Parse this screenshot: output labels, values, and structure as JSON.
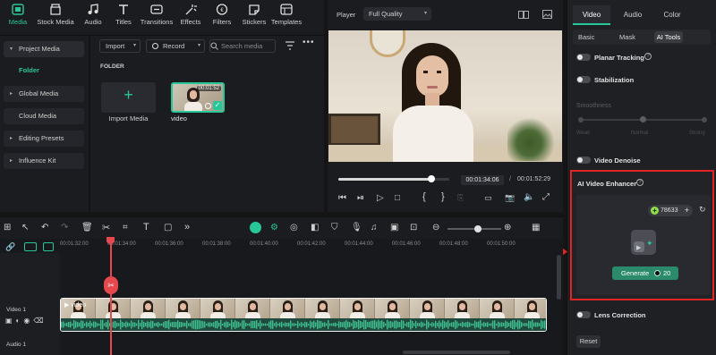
{
  "toolbar": {
    "tabs": [
      {
        "label": "Media",
        "icon": "media-icon",
        "active": true
      },
      {
        "label": "Stock Media",
        "icon": "stock-media-icon"
      },
      {
        "label": "Audio",
        "icon": "audio-icon"
      },
      {
        "label": "Titles",
        "icon": "titles-icon"
      },
      {
        "label": "Transitions",
        "icon": "transitions-icon"
      },
      {
        "label": "Effects",
        "icon": "effects-icon"
      },
      {
        "label": "Filters",
        "icon": "filters-icon"
      },
      {
        "label": "Stickers",
        "icon": "stickers-icon"
      },
      {
        "label": "Templates",
        "icon": "templates-icon"
      }
    ]
  },
  "sidenav": {
    "project_media": "Project Media",
    "folder": "Folder",
    "global_media": "Global Media",
    "cloud_media": "Cloud Media",
    "editing_presets": "Editing Presets",
    "influence_kit": "Influence Kit"
  },
  "media": {
    "import_label": "Import",
    "record_label": "Record",
    "search_placeholder": "Search media",
    "folder_heading": "FOLDER",
    "import_media_label": "Import Media",
    "clip_name": "video",
    "clip_duration": "00:01:52"
  },
  "player": {
    "label": "Player",
    "quality": "Full Quality",
    "current_time": "00:01:34:06",
    "separator": "/",
    "total_time": "00:01:52:29",
    "progress": 0.84
  },
  "inspector": {
    "tabs": [
      "Video",
      "Audio",
      "Color"
    ],
    "subtabs": [
      "Basic",
      "Mask",
      "AI Tools"
    ],
    "planar_tracking": "Planar Tracking",
    "stabilization": "Stabilization",
    "smoothness": "Smoothness",
    "smooth_weak": "Weak",
    "smooth_normal": "Normal",
    "smooth_strong": "Strong",
    "video_denoise": "Video Denoise",
    "ai_enhancer": "AI Video Enhancer",
    "credits": "78633",
    "generate": "Generate",
    "generate_cost": "20",
    "lens_correction": "Lens Correction",
    "reset": "Reset"
  },
  "timeline": {
    "ruler": [
      "00:01:32:00",
      "00:01:34:00",
      "00:01:36:00",
      "00:01:38:00",
      "00:01:40:00",
      "00:01:42:00",
      "00:01:44:00",
      "00:01:46:00",
      "00:01:48:00",
      "00:01:50:00"
    ],
    "video_track": "Video 1",
    "audio_track": "Audio 1",
    "clip_label": "video"
  },
  "colors": {
    "accent": "#27c79a",
    "highlight_red": "#e02424",
    "generate_bg": "#2a8a6a"
  }
}
